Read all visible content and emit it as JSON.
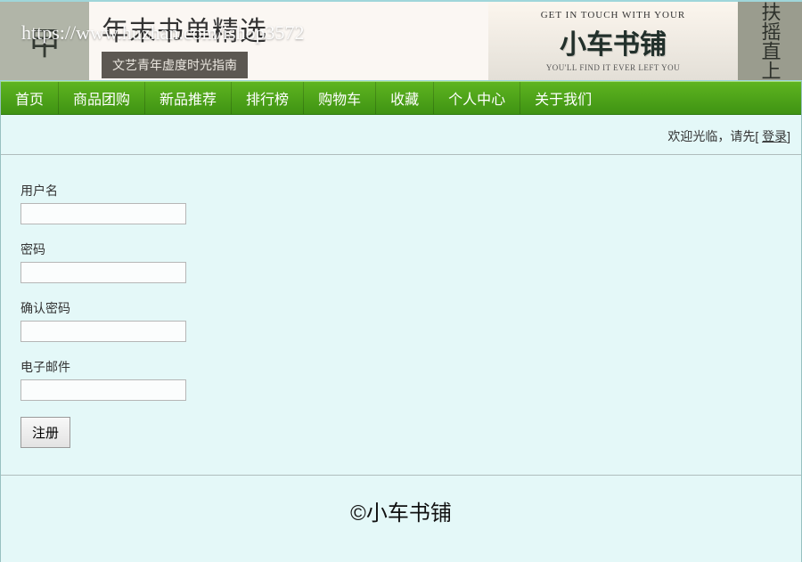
{
  "banner": {
    "left_char": "甲",
    "title": "年末书单精选",
    "subtitle": "文艺青年虚度时光指南",
    "eng_top": "GET IN TOUCH WITH YOUR",
    "shop_name": "小车书铺",
    "eng_bottom": "YOU'LL FIND IT EVER LEFT YOU",
    "right_vert": "扶摇直上",
    "watermark": "https://www.huzhan.com/ishop3572"
  },
  "nav": [
    "首页",
    "商品团购",
    "新品推荐",
    "排行榜",
    "购物车",
    "收藏",
    "个人中心",
    "关于我们"
  ],
  "welcome": {
    "prefix": "欢迎光临，请先[ ",
    "login": "登录",
    "suffix": "]"
  },
  "form": {
    "username_label": "用户名",
    "password_label": "密码",
    "confirm_label": "确认密码",
    "email_label": "电子邮件",
    "submit": "注册"
  },
  "footer": "©小车书铺"
}
